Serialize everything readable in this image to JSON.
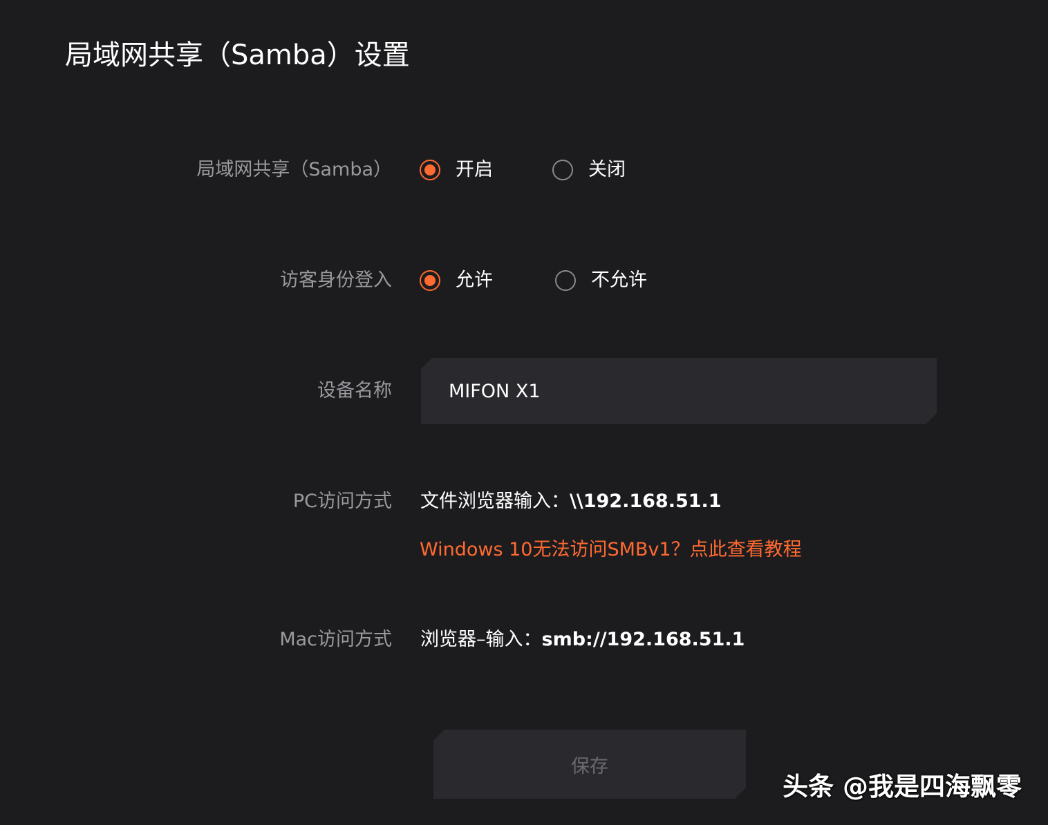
{
  "page": {
    "title": "局域网共享（Samba）设置"
  },
  "samba": {
    "label": "局域网共享（Samba）",
    "options": [
      {
        "label": "开启",
        "checked": true
      },
      {
        "label": "关闭",
        "checked": false
      }
    ]
  },
  "guest": {
    "label": "访客身份登入",
    "options": [
      {
        "label": "允许",
        "checked": true
      },
      {
        "label": "不允许",
        "checked": false
      }
    ]
  },
  "device": {
    "label": "设备名称",
    "value": "MIFON X1"
  },
  "pc": {
    "label": "PC访问方式",
    "prefix": "文件浏览器输入：",
    "address": "\\\\192.168.51.1",
    "help_link": "Windows 10无法访问SMBv1？点此查看教程"
  },
  "mac": {
    "label": "Mac访问方式",
    "prefix": "浏览器–输入：",
    "address": "smb://192.168.51.1"
  },
  "actions": {
    "save_label": "保存"
  },
  "watermark": {
    "text": "头条 @我是四海飘零"
  },
  "colors": {
    "background": "#1c1c1f",
    "accent": "#ff6a30",
    "field": "#2a2a2e",
    "label": "#9a9a9e"
  }
}
